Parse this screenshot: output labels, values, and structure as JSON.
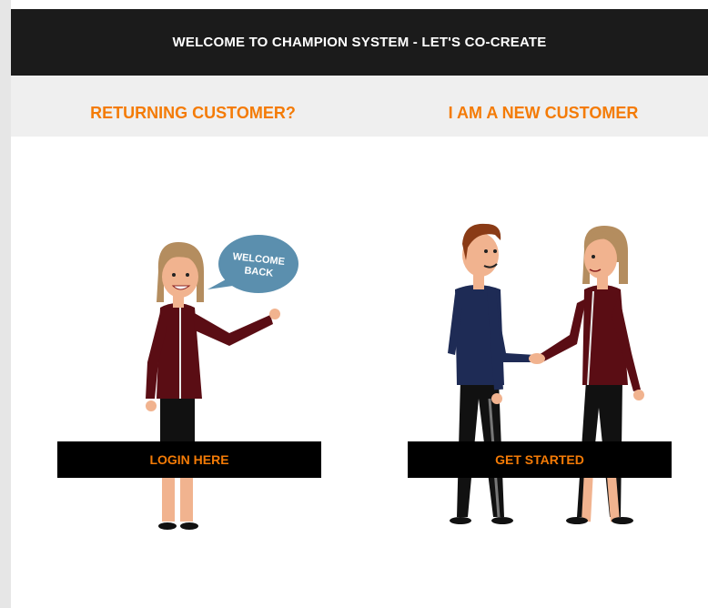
{
  "header": {
    "title": "WELCOME TO CHAMPION SYSTEM - LET'S CO-CREATE"
  },
  "returning": {
    "heading": "RETURNING CUSTOMER?",
    "bubble_line1": "WELCOME",
    "bubble_line2": "BACK",
    "button_label": "LOGIN HERE"
  },
  "new_customer": {
    "heading": "I AM A NEW CUSTOMER",
    "button_label": "GET STARTED"
  },
  "colors": {
    "accent": "#f47b06",
    "header_bg": "#1b1b1b",
    "subheader_bg": "#efefef",
    "button_bg": "#000000",
    "bubble": "#5b8fae",
    "jacket_maroon": "#5a0d14",
    "jacket_navy": "#1e2b55",
    "hair_blonde": "#b48d5f",
    "hair_brown": "#8a3b16",
    "skin": "#f1b38f"
  }
}
